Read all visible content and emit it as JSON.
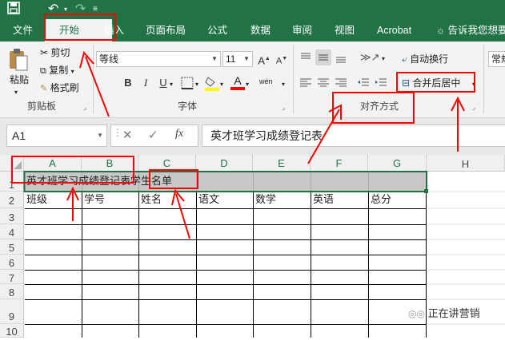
{
  "titlebar": {
    "save_icon": "save-icon",
    "undo_icon": "undo-icon",
    "redo_icon": "redo-icon"
  },
  "menu": {
    "tabs": [
      "文件",
      "开始",
      "插入",
      "页面布局",
      "公式",
      "数据",
      "审阅",
      "视图",
      "Acrobat"
    ],
    "tell_me": "告诉我您想要"
  },
  "ribbon": {
    "clipboard": {
      "paste": "粘贴",
      "cut": "剪切",
      "copy": "复制",
      "format_painter": "格式刷",
      "group": "剪贴板"
    },
    "font": {
      "font_name": "等线",
      "font_size": "11",
      "bold": "B",
      "italic": "I",
      "underline": "U",
      "font_color_letter": "A",
      "phonetic": "wén",
      "group": "字体"
    },
    "alignment": {
      "wrap_text": "自动换行",
      "merge_center": "合并后居中",
      "group": "对齐方式"
    },
    "number": {
      "format": "常规"
    }
  },
  "formula_bar": {
    "name_box": "A1",
    "fx": "fx",
    "cancel": "✕",
    "confirm": "✓",
    "formula": "英才班学习成绩登记表"
  },
  "sheet": {
    "columns": [
      "A",
      "B",
      "C",
      "D",
      "E",
      "F",
      "G",
      "H"
    ],
    "rows": [
      "1",
      "2",
      "3",
      "4",
      "5",
      "6",
      "7",
      "8",
      "9",
      "10"
    ],
    "title": "英才班学习成绩登记表学生名单",
    "headers": [
      "班级",
      "学号",
      "姓名",
      "语文",
      "数学",
      "英语",
      "总分"
    ]
  },
  "watermark": {
    "text": "正在讲营销"
  },
  "colors": {
    "excel_green": "#217346",
    "annotation_red": "#ff0000"
  }
}
